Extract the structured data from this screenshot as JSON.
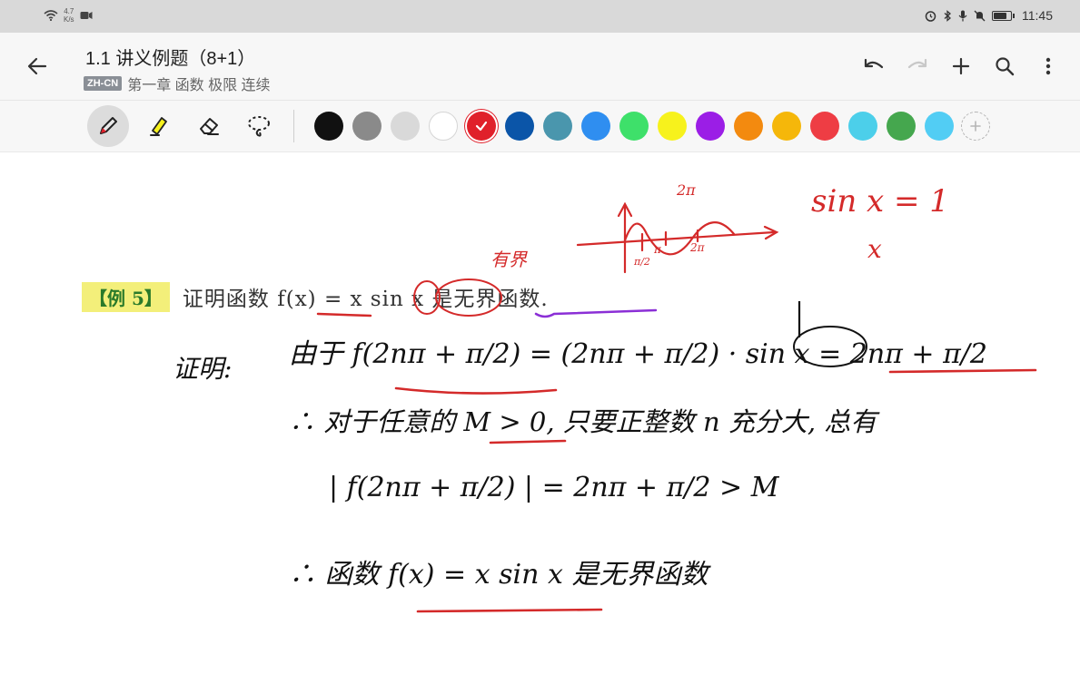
{
  "status": {
    "net_speed_value": "4.7",
    "net_speed_unit": "K/s",
    "time": "11:45",
    "battery_level": 0.85
  },
  "header": {
    "title": "1.1 讲义例题（8+1）",
    "lang_badge": "ZH-CN",
    "chapter": "第一章 函数 极限 连续"
  },
  "toolbar": {
    "tools": [
      "pen-icon",
      "highlighter-icon",
      "eraser-icon",
      "lasso-icon"
    ],
    "active_tool": "pen",
    "colors": [
      "#111111",
      "#8a8a8a",
      "#d9d9d9",
      "#ffffff",
      "#e0202a",
      "#0b55a8",
      "#4a96ad",
      "#2f8ef0",
      "#3ee06a",
      "#f7f21c",
      "#9b1ee6",
      "#f38a0f",
      "#f5b70a",
      "#ee3d44",
      "#4ccfea",
      "#45a74e",
      "#52cdf4"
    ],
    "selected_color_index": 4
  },
  "document": {
    "example_tag": "【例 5】",
    "problem_text": "证明函数 f(x) = x sin x 是无界函数.",
    "graph_label_2pi": "2π",
    "graph_tick_pi": "π",
    "graph_tick_pi_half": "π/2",
    "graph_tick_2pi": "2π",
    "annotation_bounded": "有界",
    "note_sinx_eq_1": "sin x = 1",
    "note_x": "x",
    "proof_line1_label": "证明:",
    "proof_line1": "由于 f(2nπ + π/2) = (2nπ + π/2) · sin x = 2nπ + π/2",
    "proof_line2": "∴ 对于任意的 M > 0, 只要正整数 n 充分大, 总有",
    "proof_line3": "| f(2nπ + π/2) | = 2nπ + π/2 > M",
    "proof_line4": "∴ 函数 f(x) = x sin x 是无界函数"
  }
}
